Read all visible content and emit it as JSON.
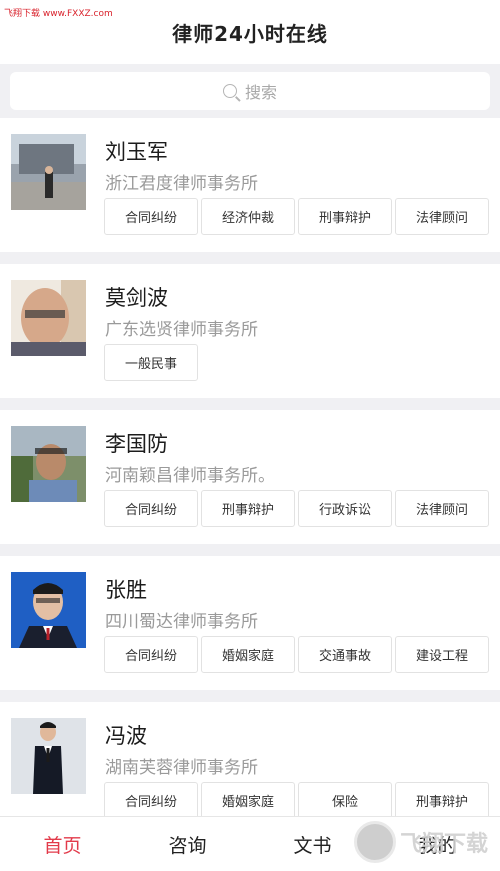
{
  "watermark": "飞翔下载 www.FXXZ.com",
  "header": {
    "title": "律师24小时在线"
  },
  "search": {
    "placeholder": "搜索"
  },
  "lawyers": [
    {
      "name": "刘玉军",
      "firm": "浙江君度律师事务所",
      "tags": [
        "合同纠纷",
        "经济仲裁",
        "刑事辩护",
        "法律顾问"
      ]
    },
    {
      "name": "莫剑波",
      "firm": "广东选贤律师事务所",
      "tags": [
        "一般民事"
      ]
    },
    {
      "name": "李国防",
      "firm": "河南颖昌律师事务所。",
      "tags": [
        "合同纠纷",
        "刑事辩护",
        "行政诉讼",
        "法律顾问"
      ]
    },
    {
      "name": "张胜",
      "firm": "四川蜀达律师事务所",
      "tags": [
        "合同纠纷",
        "婚姻家庭",
        "交通事故",
        "建设工程"
      ]
    },
    {
      "name": "冯波",
      "firm": "湖南芙蓉律师事务所",
      "tags": [
        "合同纠纷",
        "婚姻家庭",
        "保险",
        "刑事辩护"
      ]
    }
  ],
  "tabbar": {
    "home": "首页",
    "consult": "咨询",
    "documents": "文书",
    "mine": "我的"
  },
  "brand_watermark": "飞翔下载",
  "colors": {
    "accent": "#e23a4a",
    "background": "#f0f0f3"
  }
}
